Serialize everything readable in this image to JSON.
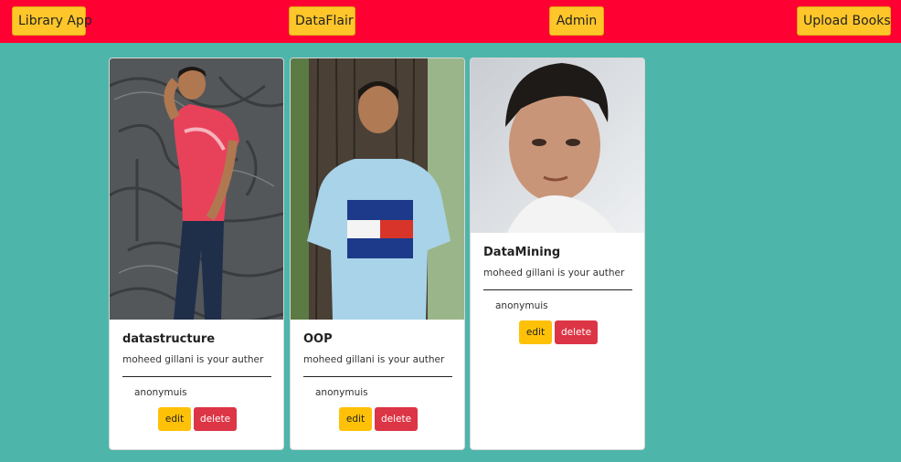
{
  "navbar": {
    "brand": "Library App",
    "link1": "DataFlair",
    "link2": "Admin",
    "link3": "Upload Books"
  },
  "books": [
    {
      "title": "datastructure",
      "author_text": "moheed gillani is your auther",
      "publisher": "anonymuis",
      "edit_label": "edit",
      "delete_label": "delete"
    },
    {
      "title": "OOP",
      "author_text": "moheed gillani is your auther",
      "publisher": "anonymuis",
      "edit_label": "edit",
      "delete_label": "delete"
    },
    {
      "title": "DataMining",
      "author_text": "moheed gillani is your auther",
      "publisher": "anonymuis",
      "edit_label": "edit",
      "delete_label": "delete"
    }
  ],
  "colors": {
    "navbar_bg": "#ff0033",
    "page_bg": "#4db5aa",
    "nav_button": "#ffc62a",
    "edit_button": "#ffc107",
    "delete_button": "#dc3545"
  }
}
